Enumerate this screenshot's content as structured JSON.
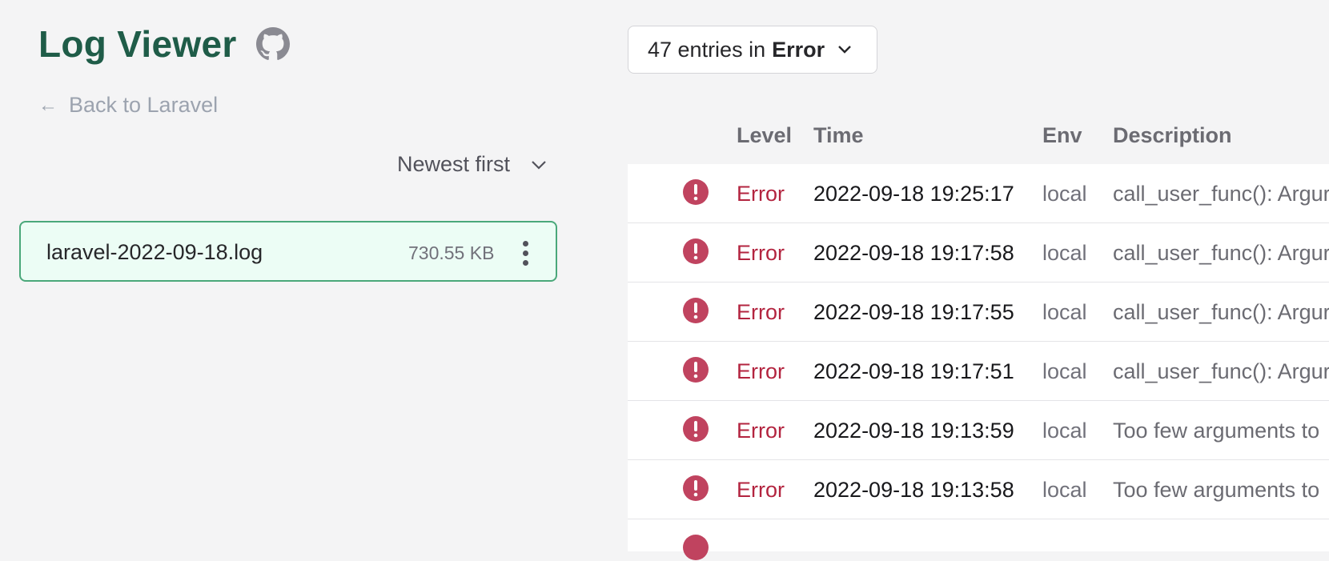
{
  "sidebar": {
    "title": "Log Viewer",
    "github_icon": "github-icon",
    "back_label": "Back to Laravel",
    "sort_label": "Newest first",
    "file": {
      "name": "laravel-2022-09-18.log",
      "size": "730.55 KB"
    }
  },
  "main": {
    "entries_prefix": "47 entries in",
    "entries_level": "Error",
    "columns": {
      "level": "Level",
      "time": "Time",
      "env": "Env",
      "description": "Description"
    },
    "rows": [
      {
        "level": "Error",
        "time": "2022-09-18 19:25:17",
        "env": "local",
        "description": "call_user_func(): Argur"
      },
      {
        "level": "Error",
        "time": "2022-09-18 19:17:58",
        "env": "local",
        "description": "call_user_func(): Argur"
      },
      {
        "level": "Error",
        "time": "2022-09-18 19:17:55",
        "env": "local",
        "description": "call_user_func(): Argur"
      },
      {
        "level": "Error",
        "time": "2022-09-18 19:17:51",
        "env": "local",
        "description": "call_user_func(): Argur"
      },
      {
        "level": "Error",
        "time": "2022-09-18 19:13:59",
        "env": "local",
        "description": "Too few arguments to"
      },
      {
        "level": "Error",
        "time": "2022-09-18 19:13:58",
        "env": "local",
        "description": "Too few arguments to"
      }
    ]
  },
  "colors": {
    "brand": "#1f5c48",
    "error": "#b3243f",
    "error_icon": "#c0435f",
    "selected_bg": "#ecfdf5",
    "selected_border": "#4aa87a"
  }
}
